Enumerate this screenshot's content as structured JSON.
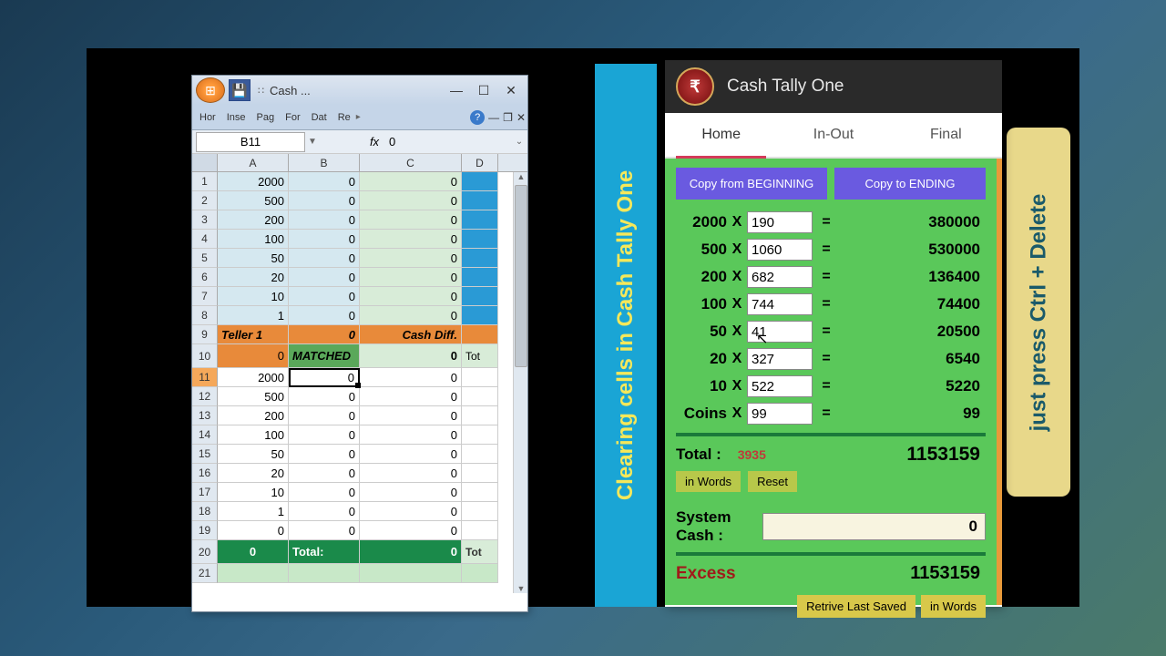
{
  "excel": {
    "title": "Cash ...",
    "ribbon": [
      "Hor",
      "Inse",
      "Pag",
      "For",
      "Dat",
      "Re"
    ],
    "namebox": "B11",
    "fx": "fx",
    "fx_value": "0",
    "cols": [
      "A",
      "B",
      "C",
      "D"
    ],
    "rows": [
      {
        "n": "1",
        "a": "2000",
        "b": "0",
        "c": "0",
        "d": ""
      },
      {
        "n": "2",
        "a": "500",
        "b": "0",
        "c": "0",
        "d": ""
      },
      {
        "n": "3",
        "a": "200",
        "b": "0",
        "c": "0",
        "d": ""
      },
      {
        "n": "4",
        "a": "100",
        "b": "0",
        "c": "0",
        "d": ""
      },
      {
        "n": "5",
        "a": "50",
        "b": "0",
        "c": "0",
        "d": ""
      },
      {
        "n": "6",
        "a": "20",
        "b": "0",
        "c": "0",
        "d": ""
      },
      {
        "n": "7",
        "a": "10",
        "b": "0",
        "c": "0",
        "d": ""
      },
      {
        "n": "8",
        "a": "1",
        "b": "0",
        "c": "0",
        "d": ""
      }
    ],
    "r9": {
      "n": "9",
      "a": "Teller 1",
      "b": "0",
      "c": "Cash Diff.",
      "d": ""
    },
    "r10": {
      "n": "10",
      "a": "0",
      "b": "MATCHED",
      "c": "0",
      "d": "Tot"
    },
    "r11": {
      "n": "11",
      "a": "2000",
      "b": "0",
      "c": "0",
      "d": ""
    },
    "rows2": [
      {
        "n": "12",
        "a": "500",
        "b": "0",
        "c": "0",
        "d": ""
      },
      {
        "n": "13",
        "a": "200",
        "b": "0",
        "c": "0",
        "d": ""
      },
      {
        "n": "14",
        "a": "100",
        "b": "0",
        "c": "0",
        "d": ""
      },
      {
        "n": "15",
        "a": "50",
        "b": "0",
        "c": "0",
        "d": ""
      },
      {
        "n": "16",
        "a": "20",
        "b": "0",
        "c": "0",
        "d": ""
      },
      {
        "n": "17",
        "a": "10",
        "b": "0",
        "c": "0",
        "d": ""
      },
      {
        "n": "18",
        "a": "1",
        "b": "0",
        "c": "0",
        "d": ""
      },
      {
        "n": "19",
        "a": "0",
        "b": "0",
        "c": "0",
        "d": ""
      }
    ],
    "r20": {
      "n": "20",
      "a": "0",
      "b": "Total:",
      "c": "0",
      "d": "Tot"
    },
    "r21": {
      "n": "21",
      "a": "",
      "b": "",
      "c": "",
      "d": ""
    }
  },
  "blue_banner": "Clearing cells in Cash Tally One",
  "yellow_banner": "just press Ctrl + Delete",
  "tally": {
    "title": "Cash Tally One",
    "tabs": [
      "Home",
      "In-Out",
      "Final"
    ],
    "copy_from": "Copy from BEGINNING",
    "copy_to": "Copy to ENDING",
    "denoms": [
      {
        "label": "2000",
        "x": "X",
        "count": "190",
        "eq": "=",
        "total": "380000"
      },
      {
        "label": "500",
        "x": "X",
        "count": "1060",
        "eq": "=",
        "total": "530000"
      },
      {
        "label": "200",
        "x": "X",
        "count": "682",
        "eq": "=",
        "total": "136400"
      },
      {
        "label": "100",
        "x": "X",
        "count": "744",
        "eq": "=",
        "total": "74400"
      },
      {
        "label": "50",
        "x": "X",
        "count": "41",
        "eq": "=",
        "total": "20500"
      },
      {
        "label": "20",
        "x": "X",
        "count": "327",
        "eq": "=",
        "total": "6540"
      },
      {
        "label": "10",
        "x": "X",
        "count": "522",
        "eq": "=",
        "total": "5220"
      },
      {
        "label": "Coins",
        "x": "X",
        "count": "99",
        "eq": "=",
        "total": "99"
      }
    ],
    "total_label": "Total :",
    "total_count": "3935",
    "total_value": "1153159",
    "in_words": "in Words",
    "reset": "Reset",
    "syscash_label": "System Cash :",
    "syscash_value": "0",
    "excess_label": "Excess",
    "excess_value": "1153159",
    "retrieve": "Retrive Last Saved",
    "in_words2": "in Words"
  }
}
